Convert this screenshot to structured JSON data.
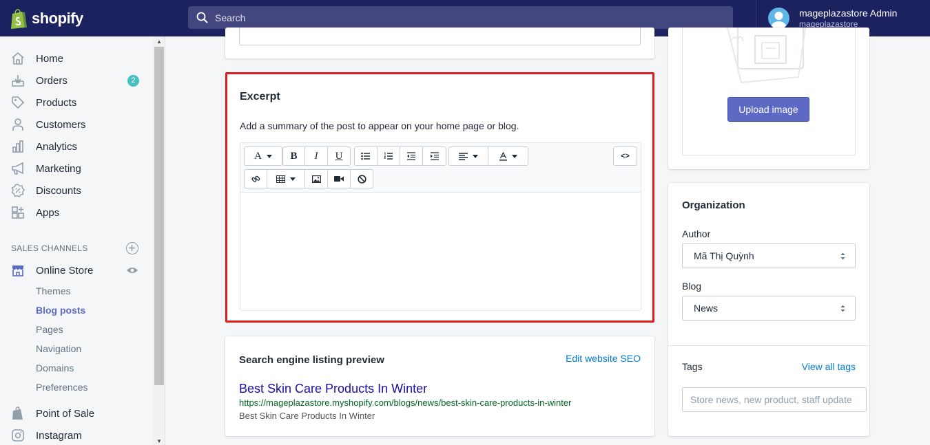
{
  "topbar": {
    "logo_text": "shopify",
    "search_placeholder": "Search",
    "user_name": "mageplazastore Admin",
    "user_store": "mageplazastore"
  },
  "sidebar": {
    "items": [
      {
        "label": "Home",
        "icon": "home-icon"
      },
      {
        "label": "Orders",
        "icon": "orders-icon",
        "badge": "2"
      },
      {
        "label": "Products",
        "icon": "tag-icon"
      },
      {
        "label": "Customers",
        "icon": "customer-icon"
      },
      {
        "label": "Analytics",
        "icon": "analytics-icon"
      },
      {
        "label": "Marketing",
        "icon": "megaphone-icon"
      },
      {
        "label": "Discounts",
        "icon": "discount-icon"
      },
      {
        "label": "Apps",
        "icon": "apps-icon"
      }
    ],
    "sales_channels_title": "SALES CHANNELS",
    "online_store": "Online Store",
    "online_store_sub": [
      "Themes",
      "Blog posts",
      "Pages",
      "Navigation",
      "Domains",
      "Preferences"
    ],
    "active_sub": "Blog posts",
    "point_of_sale": "Point of Sale",
    "instagram": "Instagram"
  },
  "excerpt": {
    "title": "Excerpt",
    "description": "Add a summary of the post to appear on your home page or blog.",
    "toolbar": {
      "font_label": "A",
      "bold_label": "B",
      "italic_label": "I",
      "underline_label": "U",
      "html_label": "<>"
    }
  },
  "seo": {
    "title": "Search engine listing preview",
    "edit_link": "Edit website SEO",
    "preview_title": "Best Skin Care Products In Winter",
    "preview_url": "https://mageplazastore.myshopify.com/blogs/news/best-skin-care-products-in-winter",
    "preview_description": "Best Skin Care Products In Winter"
  },
  "image": {
    "upload_button": "Upload image"
  },
  "organization": {
    "title": "Organization",
    "author_label": "Author",
    "author_value": "Mã Thị Quỳnh",
    "blog_label": "Blog",
    "blog_value": "News",
    "tags_label": "Tags",
    "tags_link": "View all tags",
    "tags_placeholder": "Store news, new product, staff update"
  },
  "colors": {
    "topbar": "#1c2260",
    "accent": "#5c6ac4",
    "link": "#007ace",
    "highlight_border": "#e01b1b"
  }
}
